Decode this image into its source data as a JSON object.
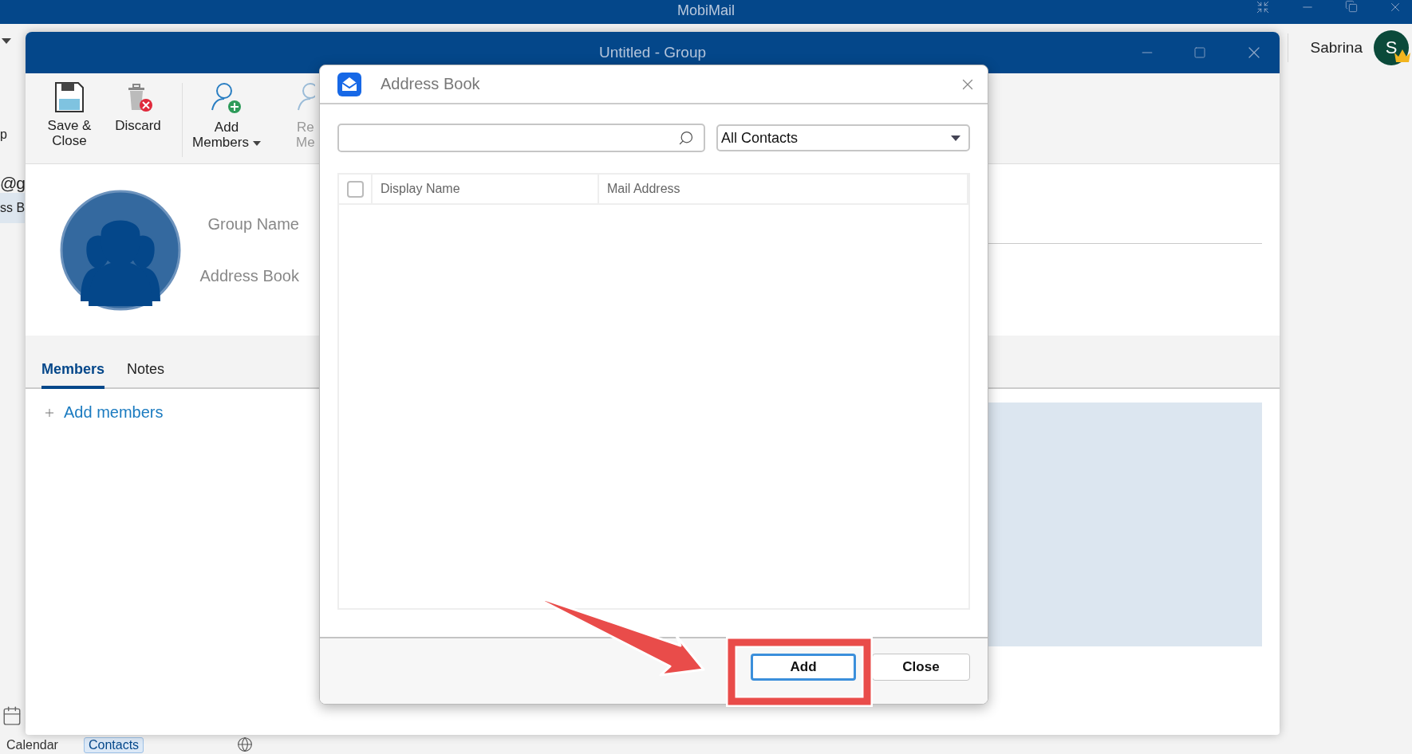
{
  "app": {
    "title": "MobiMail",
    "user": {
      "name": "Sabrina",
      "initial": "S",
      "premium": true
    }
  },
  "background": {
    "left_texts": [
      {
        "text": "p",
        "selected": false
      },
      {
        "text": "@g",
        "selected": false
      },
      {
        "text": "ss B",
        "selected": true
      }
    ],
    "nav": [
      {
        "kind": "calendar",
        "label": "Calendar",
        "selected": false
      },
      {
        "kind": "contacts",
        "label": "Contacts",
        "selected": true
      },
      {
        "kind": "globe",
        "selected": false
      }
    ]
  },
  "group_window": {
    "title": "Untitled - Group",
    "ribbon": [
      {
        "kind": "save",
        "lines": [
          "Save &",
          "Close"
        ],
        "dropdown": false,
        "disabled": false
      },
      {
        "kind": "discard",
        "lines": [
          "Discard"
        ],
        "dropdown": false,
        "disabled": false
      },
      {
        "kind": "add",
        "lines": [
          "Add",
          "Members"
        ],
        "dropdown": true,
        "disabled": false
      },
      {
        "kind": "remove",
        "lines": [
          "Re",
          "Me"
        ],
        "dropdown": false,
        "disabled": true
      }
    ],
    "fields": [
      "Group Name",
      "Address Book"
    ],
    "tabs": [
      {
        "label": "Members",
        "selected": true
      },
      {
        "label": "Notes",
        "selected": false
      }
    ],
    "add_members_link": "Add members"
  },
  "dialog": {
    "title": "Address Book",
    "filter": "All Contacts",
    "select_all": {
      "checked": false
    },
    "columns": [
      "Display Name",
      "Mail Address"
    ],
    "buttons": [
      {
        "label": "Add",
        "focused": true
      },
      {
        "label": "Close",
        "focused": false
      }
    ]
  },
  "annotations": {
    "arrow": true,
    "highlight_frame": true
  }
}
